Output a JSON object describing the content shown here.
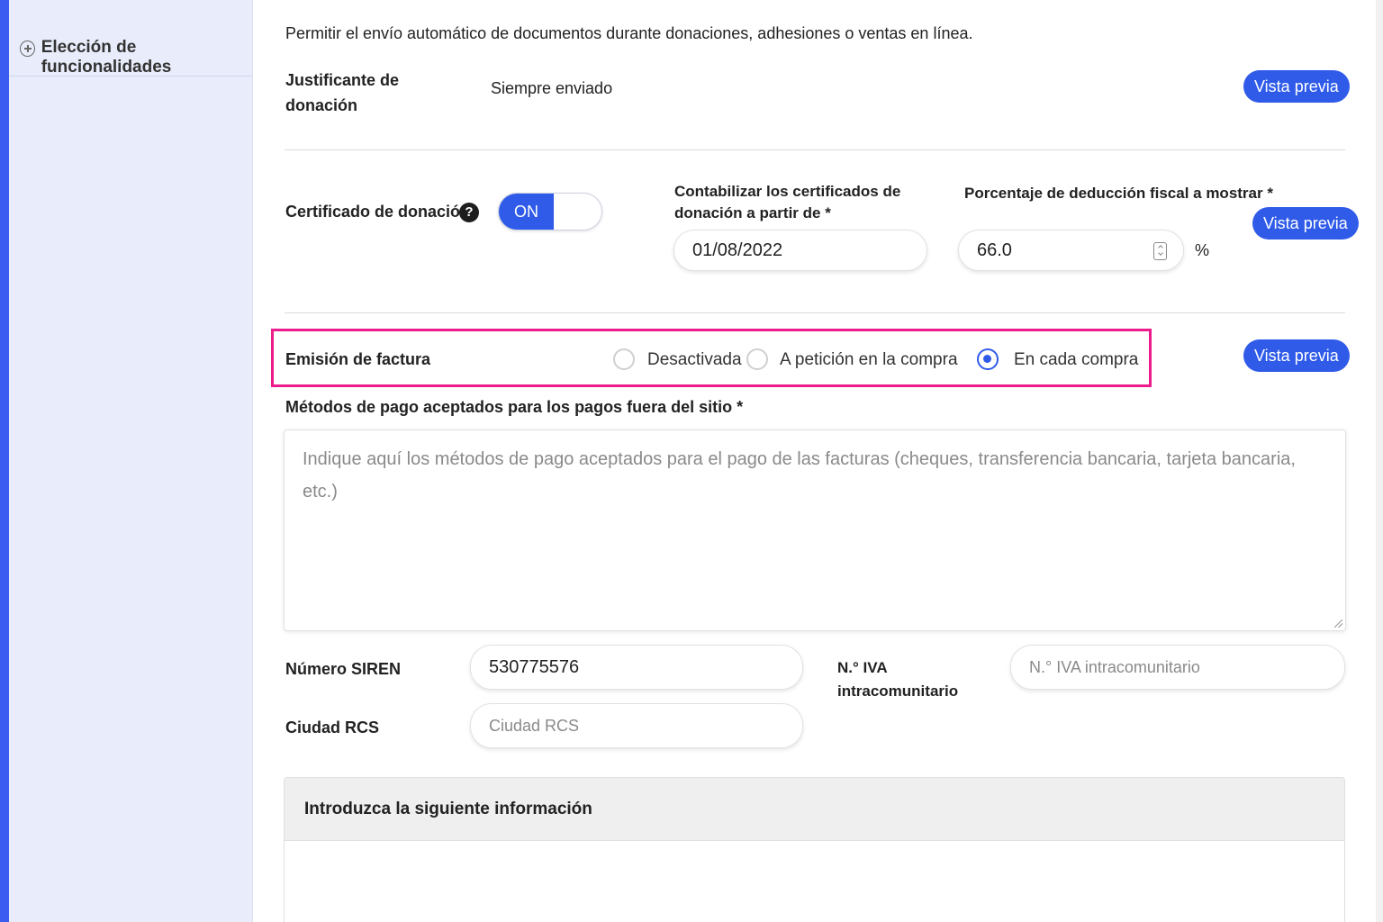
{
  "sidebar": {
    "items": [
      {
        "label": "Elección de funcionalidades",
        "icon": "plus-circle-icon"
      }
    ]
  },
  "intro_text": "Permitir el envío automático de documentos durante donaciones, adhesiones o ventas en línea.",
  "receipt": {
    "label": "Justificante de donación",
    "value": "Siempre enviado",
    "preview_label": "Vista previa"
  },
  "certificate": {
    "label": "Certificado de donación",
    "help_icon": "question-circle-icon",
    "toggle_label": "ON",
    "count_from_label": "Contabilizar los certificados de donación a partir de *",
    "count_from_value": "01/08/2022",
    "deduction_label": "Porcentaje de deducción fiscal a mostrar *",
    "deduction_value": "66.0",
    "deduction_unit": "%",
    "preview_label": "Vista previa"
  },
  "invoice": {
    "label": "Emisión de factura",
    "options": [
      {
        "label": "Desactivada",
        "selected": false
      },
      {
        "label": "A petición en la compra",
        "selected": false
      },
      {
        "label": "En cada compra",
        "selected": true
      }
    ],
    "preview_label": "Vista previa"
  },
  "payment_methods": {
    "label": "Métodos de pago aceptados para los pagos fuera del sitio *",
    "placeholder": "Indique aquí los métodos de pago aceptados para el pago de las facturas (cheques, transferencia bancaria, tarjeta bancaria, etc.)",
    "value": ""
  },
  "siren": {
    "label": "Número SIREN",
    "value": "530775576"
  },
  "vat": {
    "label": "N.° IVA intracomunitario",
    "placeholder": "N.° IVA intracomunitario"
  },
  "rcs": {
    "label": "Ciudad RCS",
    "placeholder": "Ciudad RCS"
  },
  "info_panel": {
    "title": "Introduzca la siguiente información"
  },
  "colors": {
    "accent": "#2f5be8",
    "highlight": "#ec1c8c",
    "sidebar_bg": "#e9edfb"
  }
}
